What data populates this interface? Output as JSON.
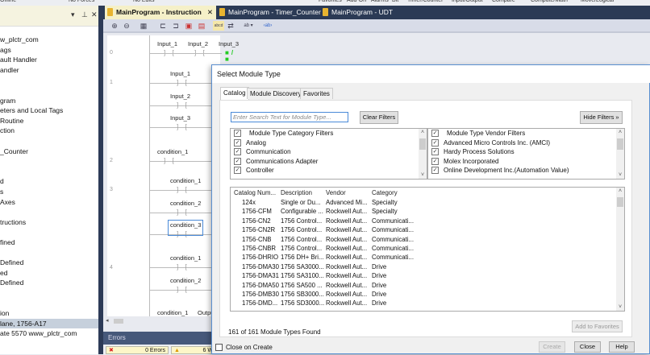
{
  "topstrip": {
    "items": [
      "Offline",
      "No Forces",
      "No Edits",
      "Favorites",
      "Add-On",
      "Alarms",
      "Bit",
      "Timer/Counter",
      "Input/Output",
      "Compare",
      "Compute/Math",
      "Move/Logical"
    ]
  },
  "tree": {
    "items": [
      "w_plctr_com",
      "ags",
      "ault Handler",
      "andler",
      "",
      "",
      "gram",
      "eters and Local Tags",
      "Routine",
      "ction",
      "",
      "_Counter",
      "",
      "",
      "d",
      "s",
      " Axes",
      "",
      "tructions",
      "",
      "fined",
      "",
      " Defined",
      "ed",
      "Defined",
      "",
      "",
      "ion",
      "lane, 1756-A17",
      "ate 5570 www_plctr_com"
    ],
    "selected_index": 28
  },
  "tabs": [
    {
      "label": "MainProgram - Instruction",
      "active": true
    },
    {
      "label": "MainProgram - Timer_Counter"
    },
    {
      "label": "MainProgram - UDT"
    }
  ],
  "ladder": {
    "rungs": [
      "0",
      "1",
      "2",
      "3",
      "4"
    ],
    "tags": {
      "r0a": "Input_1",
      "r0b": "Input_2",
      "r0c": "Input_3",
      "r1a": "Input_1",
      "r1b": "Input_2",
      "r1c": "Input_3",
      "r2a": "condition_1",
      "r3a": "condition_1",
      "r3b": "condition_2",
      "r3c": "condition_3",
      "r4a": "condition_1",
      "r4b": "condition_2",
      "r5a": "condition_1",
      "r5b": "Outpu"
    }
  },
  "errors": {
    "title": "Errors",
    "errors_label": "0 Errors",
    "warnings_label": "6 W"
  },
  "dialog": {
    "title": "Select Module Type",
    "tabs": [
      "Catalog",
      "Module Discovery",
      "Favorites"
    ],
    "search_placeholder": "Enter Search Text for Module Type...",
    "clear_filters": "Clear Filters",
    "hide_filters": "Hide Filters »",
    "category_filters": {
      "header": "Module Type Category Filters",
      "items": [
        "Analog",
        "Communication",
        "Communications Adapter",
        "Controller"
      ]
    },
    "vendor_filters": {
      "header": "Module Type Vendor Filters",
      "items": [
        "Advanced Micro Controls Inc. (AMCI)",
        "Hardy Process Solutions",
        "Molex Incorporated",
        "Online Development Inc.(Automation Value)"
      ]
    },
    "columns": [
      "Catalog Num...",
      "Description",
      "Vendor",
      "Category"
    ],
    "rows": [
      [
        "124x",
        "Single or Du...",
        "Advanced Mi...",
        "Specialty"
      ],
      [
        "1756-CFM",
        "Configurable ...",
        "Rockwell Aut...",
        "Specialty"
      ],
      [
        "1756-CN2",
        "1756 Control...",
        "Rockwell Aut...",
        "Communicati..."
      ],
      [
        "1756-CN2R",
        "1756 Control...",
        "Rockwell Aut...",
        "Communicati..."
      ],
      [
        "1756-CNB",
        "1756 Control...",
        "Rockwell Aut...",
        "Communicati..."
      ],
      [
        "1756-CNBR",
        "1756 Control...",
        "Rockwell Aut...",
        "Communicati..."
      ],
      [
        "1756-DHRIO",
        "1756 DH+ Bri...",
        "Rockwell Aut...",
        "Communicati..."
      ],
      [
        "1756-DMA30",
        "1756 SA3000...",
        "Rockwell Aut...",
        "Drive"
      ],
      [
        "1756-DMA31",
        "1756 SA3100...",
        "Rockwell Aut...",
        "Drive"
      ],
      [
        "1756-DMA50",
        "1756 SA500 ...",
        "Rockwell Aut...",
        "Drive"
      ],
      [
        "1756-DMB30",
        "1756 SB3000...",
        "Rockwell Aut...",
        "Drive"
      ],
      [
        "1756-DMD...",
        "1756 SD3000...",
        "Rockwell Aut...",
        "Drive"
      ]
    ],
    "found": "161 of 161 Module Types Found",
    "add_favorites": "Add to Favorites",
    "close_on_create": "Close on Create",
    "create": "Create",
    "close": "Close",
    "help": "Help"
  }
}
